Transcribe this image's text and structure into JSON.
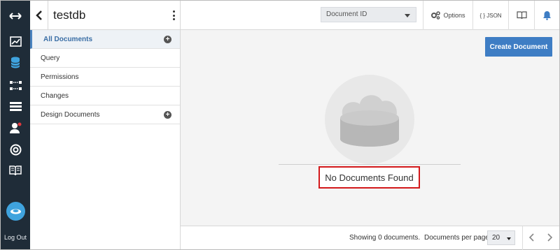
{
  "database": {
    "name": "testdb"
  },
  "leftnav": {
    "icons": [
      "expand-arrows-icon",
      "activity-chart-icon",
      "database-icon",
      "replication-icon",
      "config-icon",
      "user-icon",
      "support-icon",
      "docs-book-icon"
    ],
    "logout_label": "Log Out"
  },
  "sidebar": {
    "items": [
      {
        "label": "All Documents",
        "active": true,
        "has_add": true
      },
      {
        "label": "Query"
      },
      {
        "label": "Permissions"
      },
      {
        "label": "Changes"
      },
      {
        "label": "Design Documents",
        "has_add": true
      }
    ]
  },
  "toolbar": {
    "doc_id_select": "Document ID",
    "options_label": "Options",
    "json_label": "{ } JSON"
  },
  "main": {
    "create_button": "Create Document",
    "empty_message": "No Documents Found"
  },
  "footer": {
    "showing_text": "Showing 0 documents.",
    "per_page_label": "Documents per page:",
    "per_page_value": "20"
  },
  "colors": {
    "nav_bg": "#1f2c38",
    "accent": "#3e7dc4",
    "highlight_border": "#d3191b",
    "nav_active_icon": "#3fa3de"
  }
}
